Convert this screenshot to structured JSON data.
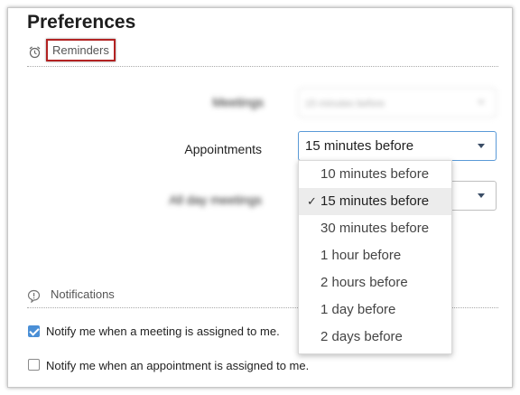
{
  "page": {
    "title": "Preferences"
  },
  "reminders": {
    "section_label": "Reminders",
    "rows": [
      {
        "label": "Meetings",
        "value": "15 minutes before"
      },
      {
        "label": "Appointments",
        "value": "15 minutes before"
      },
      {
        "label": "All day meetings",
        "value": ""
      }
    ],
    "dropdown": {
      "options": [
        "10 minutes before",
        "15 minutes before",
        "30 minutes before",
        "1 hour before",
        "2 hours before",
        "1 day before",
        "2 days before"
      ],
      "selected": "15 minutes before"
    }
  },
  "notifications": {
    "section_label": "Notifications",
    "items": [
      {
        "label": "Notify me when a meeting is assigned to me.",
        "checked": true
      },
      {
        "label": "Notify me when an appointment is assigned to me.",
        "checked": false
      }
    ]
  },
  "colors": {
    "accent": "#4a8fd6",
    "highlight_border": "#b22222",
    "selected_bg": "#ececec"
  },
  "icons": {
    "reminders": "alarm-clock-icon",
    "notifications": "speech-bubble-icon",
    "select_arrow": "caret-down-icon",
    "selected_mark": "checkmark-icon"
  }
}
